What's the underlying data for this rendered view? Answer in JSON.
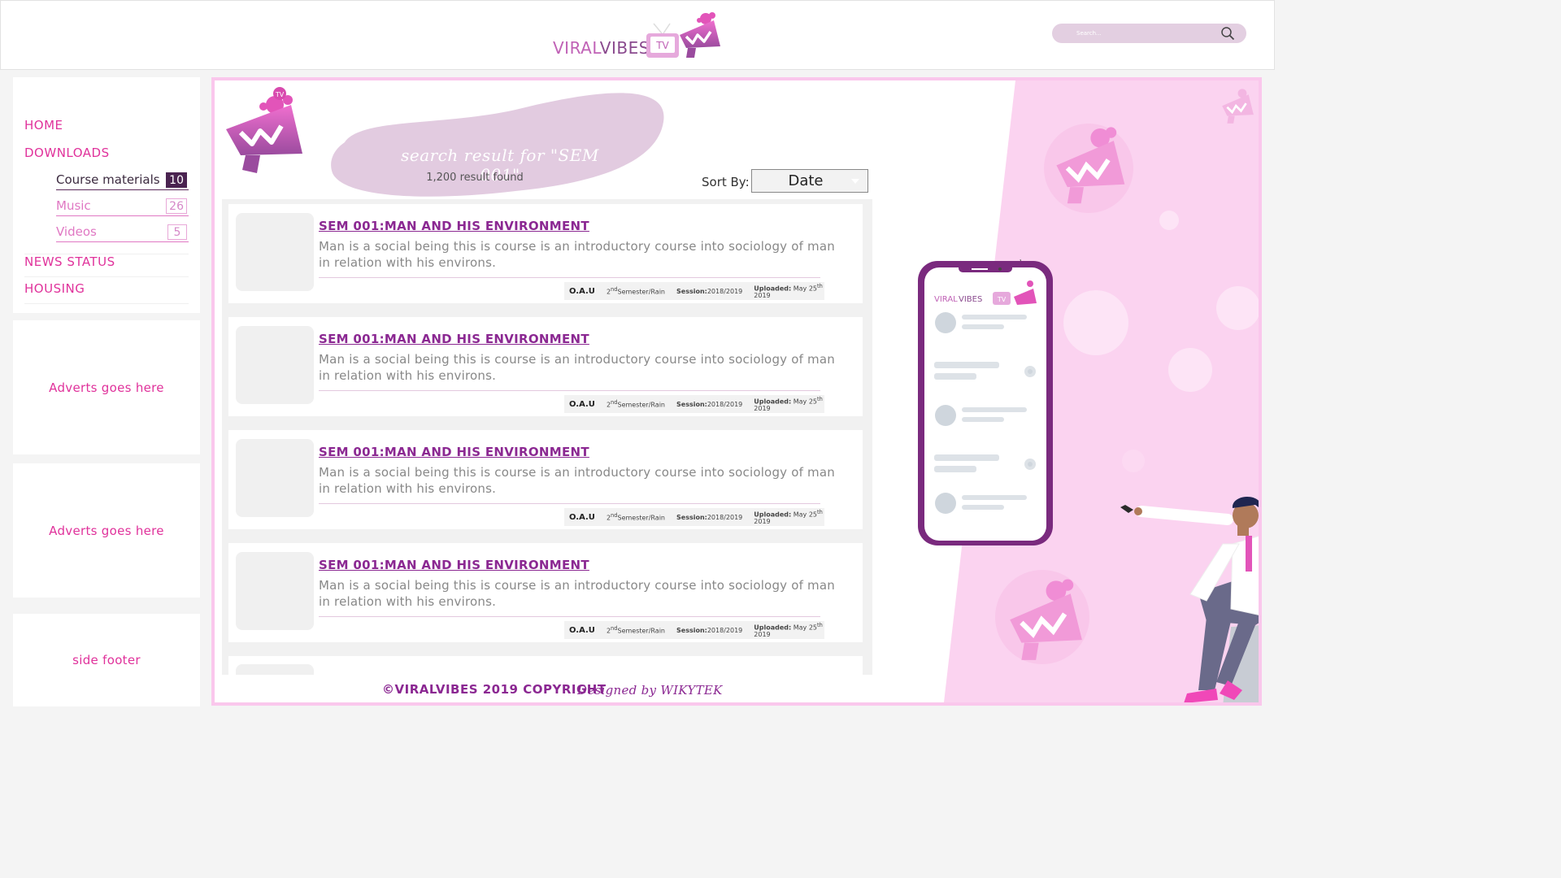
{
  "header": {
    "brand_viral": "VIRAL",
    "brand_vibes": "VIBES",
    "brand_tv": "TV",
    "search_placeholder": "Search...",
    "search_icon": "magnifier-icon"
  },
  "sidebar": {
    "nav": [
      {
        "label": "HOME"
      },
      {
        "label": "DOWNLOADS"
      },
      {
        "label": "NEWS STATUS"
      },
      {
        "label": "HOUSING"
      }
    ],
    "downloads_sub": [
      {
        "label": "Course materials",
        "count": "10",
        "active": true
      },
      {
        "label": "Music",
        "count": "26",
        "active": false
      },
      {
        "label": "Videos",
        "count": "5",
        "active": false
      }
    ],
    "advert1": "Adverts goes here",
    "advert2": "Adverts goes here",
    "side_footer": "side footer"
  },
  "main": {
    "search_title": "search result for \"SEM 001\"",
    "result_count": "1,200 result found",
    "sort_label": "Sort By:",
    "sort_value": "Date",
    "results": [
      {
        "title": "SEM 001:MAN AND HIS ENVIRONMENT",
        "desc": "Man is a social being this is course is an introductory course into sociology of man in relation with his environs.",
        "inst": "O.A.U",
        "sem_num": "2",
        "sem_sup": "nd",
        "sem_rest": "Semester/Rain",
        "session_label": "Session:",
        "session": "2018/2019",
        "uploaded_label": "Uploaded:",
        "uploaded": "May 25",
        "uploaded_sup": "th",
        "uploaded_year": "2019"
      },
      {
        "title": "SEM 001:MAN AND HIS ENVIRONMENT",
        "desc": "Man is a social being this is course is an introductory course into sociology of man in relation with his environs.",
        "inst": "O.A.U",
        "sem_num": "2",
        "sem_sup": "nd",
        "sem_rest": "Semester/Rain",
        "session_label": "Session:",
        "session": "2018/2019",
        "uploaded_label": "Uploaded:",
        "uploaded": "May 25",
        "uploaded_sup": "th",
        "uploaded_year": "2019"
      },
      {
        "title": "SEM 001:MAN AND HIS ENVIRONMENT",
        "desc": "Man is a social being this is course is an introductory course into sociology of man in relation with his environs.",
        "inst": "O.A.U",
        "sem_num": "2",
        "sem_sup": "nd",
        "sem_rest": "Semester/Rain",
        "session_label": "Session:",
        "session": "2018/2019",
        "uploaded_label": "Uploaded:",
        "uploaded": "May 25",
        "uploaded_sup": "th",
        "uploaded_year": "2019"
      },
      {
        "title": "SEM 001:MAN AND HIS ENVIRONMENT",
        "desc": "Man is a social being this is course is an introductory course into sociology of man in relation with his environs.",
        "inst": "O.A.U",
        "sem_num": "2",
        "sem_sup": "nd",
        "sem_rest": "Semester/Rain",
        "session_label": "Session:",
        "session": "2018/2019",
        "uploaded_label": "Uploaded:",
        "uploaded": "May 25",
        "uploaded_sup": "th",
        "uploaded_year": "2019"
      }
    ],
    "footer_copyright": "©VIRALVIBES 2019 COPYRIGHT",
    "footer_designed": "Designed by WIKYTEK",
    "phone_brand_viral": "VIRAL",
    "phone_brand_vibes": "VIBES",
    "phone_brand_tv": "TV"
  },
  "colors": {
    "accent": "#e0329b",
    "brand_purple": "#8b2892",
    "pink_bg": "#fbd3f0",
    "phone_frame": "#7a2a7e"
  }
}
